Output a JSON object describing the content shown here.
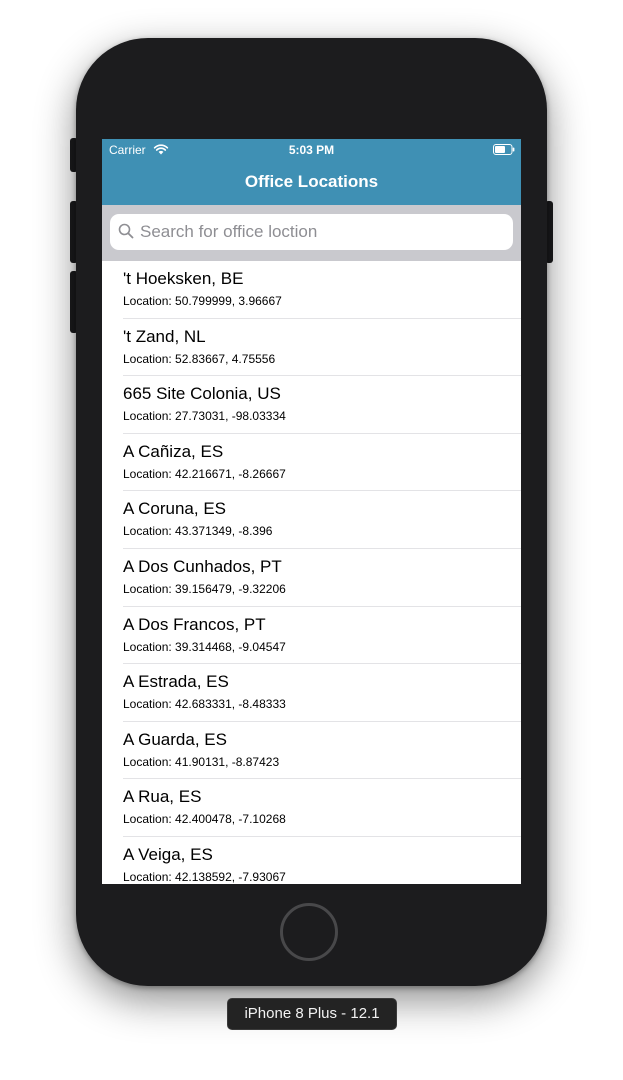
{
  "status_bar": {
    "carrier": "Carrier",
    "time": "5:03 PM",
    "wifi_icon": "wifi-icon",
    "battery_icon": "battery-icon"
  },
  "nav": {
    "title": "Office Locations"
  },
  "search": {
    "placeholder": "Search for office loction",
    "value": "",
    "icon": "search-icon"
  },
  "locations": [
    {
      "name": "'t Hoeksken, BE",
      "coords": "Location: 50.799999, 3.96667"
    },
    {
      "name": "'t Zand, NL",
      "coords": "Location: 52.83667, 4.75556"
    },
    {
      "name": "665 Site Colonia, US",
      "coords": "Location: 27.73031, -98.03334"
    },
    {
      "name": "A Cañiza, ES",
      "coords": "Location: 42.216671, -8.26667"
    },
    {
      "name": "A Coruna, ES",
      "coords": "Location: 43.371349, -8.396"
    },
    {
      "name": "A Dos Cunhados, PT",
      "coords": "Location: 39.156479, -9.32206"
    },
    {
      "name": "A Dos Francos, PT",
      "coords": "Location: 39.314468, -9.04547"
    },
    {
      "name": "A Estrada, ES",
      "coords": "Location: 42.683331, -8.48333"
    },
    {
      "name": "A Guarda, ES",
      "coords": "Location: 41.90131, -8.87423"
    },
    {
      "name": "A Rua, ES",
      "coords": "Location: 42.400478, -7.10268"
    },
    {
      "name": "A Veiga, ES",
      "coords": "Location: 42.138592, -7.93067"
    }
  ],
  "device": {
    "label": "iPhone 8 Plus - 12.1"
  },
  "colors": {
    "nav_background": "#3f90b4",
    "device_body": "#1c1c1e",
    "search_bar_background": "#c9c9ce"
  }
}
